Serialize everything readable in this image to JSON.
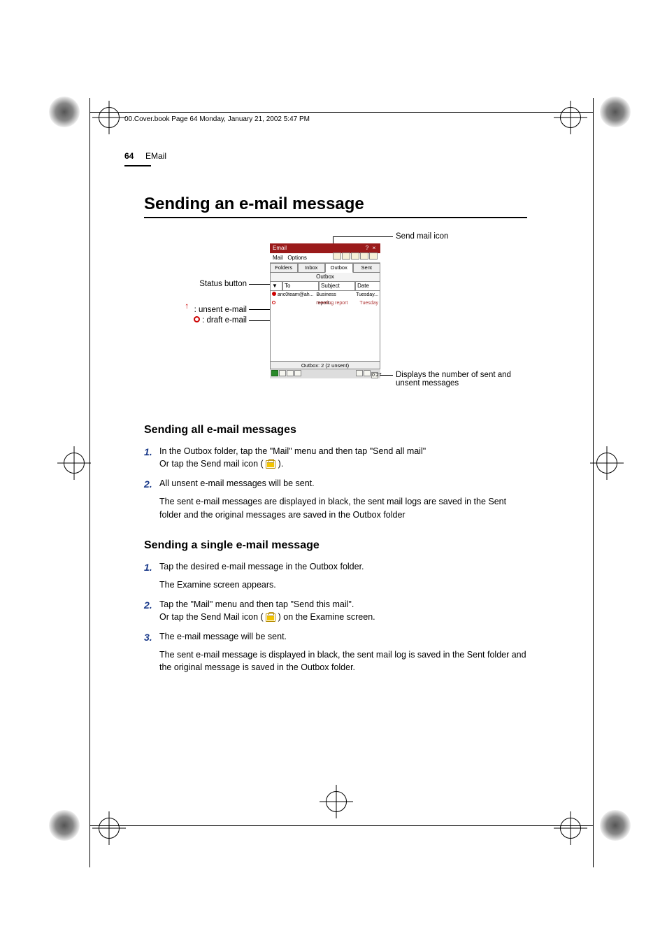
{
  "header_line": "00.Cover.book  Page 64  Monday, January 21, 2002  5:47 PM",
  "page_number": "64",
  "section": "EMail",
  "h1": "Sending an e-mail message",
  "callouts": {
    "send_icon": "Send mail icon",
    "status_btn": "Status button",
    "unsent": ": unsent e-mail",
    "draft": ": draft e-mail",
    "counter": "Displays the number of sent and unsent messages"
  },
  "device": {
    "title": "Email",
    "menu1": "Mail",
    "menu2": "Options",
    "tabs": [
      "Folders",
      "Inbox",
      "Outbox",
      "Sent"
    ],
    "subtab": "Outbox",
    "cols": {
      "sort": "▼",
      "to": "To",
      "subject": "Subject",
      "date": "Date"
    },
    "rows": [
      {
        "to": "anc0team@ah...",
        "subject": "Business report...",
        "date": "Tuesday..."
      },
      {
        "to": "",
        "subject": "meeting report",
        "date": "Tuesday"
      }
    ],
    "status": "Outbox: 2 (2 unsent)",
    "time": "0:27"
  },
  "h2a": "Sending all e-mail messages",
  "steps_a": {
    "s1a": "In the Outbox folder, tap the \"Mail\" menu and then tap \"Send all mail\"",
    "s1b": "Or tap the Send mail icon (",
    "s1c": ").",
    "s2a": "All unsent e-mail messages will be sent.",
    "s2b": "The sent e-mail messages are displayed in black, the sent mail logs are saved in the Sent folder and the original messages are saved in the Outbox folder"
  },
  "h2b": "Sending a single e-mail message",
  "steps_b": {
    "s1a": "Tap the desired e-mail message in the Outbox folder.",
    "s1b": "The Examine screen appears.",
    "s2a": "Tap the \"Mail\" menu and then tap \"Send this mail\".",
    "s2b": "Or tap the Send Mail icon (",
    "s2c": ") on the Examine screen.",
    "s3a": "The e-mail message will be sent.",
    "s3b": "The sent e-mail message is displayed in black, the sent mail log is saved in the Sent folder and the original message is saved in the Outbox folder."
  },
  "nums": {
    "n1": "1.",
    "n2": "2.",
    "n3": "3."
  }
}
